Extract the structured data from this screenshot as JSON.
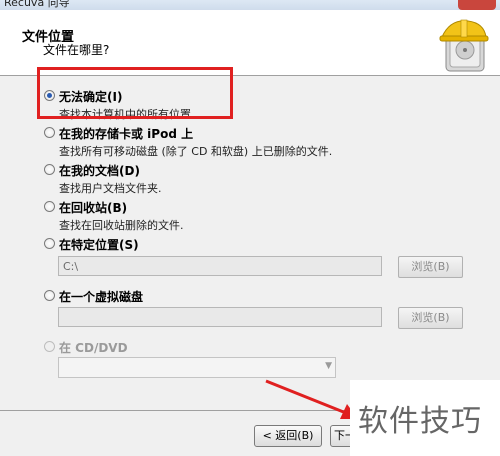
{
  "window": {
    "title": "Recuva 向导"
  },
  "header": {
    "title": "文件位置",
    "subtitle": "文件在哪里?"
  },
  "options": [
    {
      "label": "无法确定(I)",
      "desc": "查找本计算机中的所有位置.",
      "checked": true
    },
    {
      "label": "在我的存储卡或 iPod 上",
      "desc": "查找所有可移动磁盘 (除了 CD 和软盘) 上已删除的文件."
    },
    {
      "label": "在我的文档(D)",
      "desc": "查找用户文档文件夹."
    },
    {
      "label": "在回收站(B)",
      "desc": "查找在回收站删除的文件."
    },
    {
      "label": "在特定位置(S)",
      "path_value": "C:\\",
      "browse_label": "浏览(B)"
    },
    {
      "label": "在一个虚拟磁盘",
      "browse_label": "浏览(B)"
    },
    {
      "label": "在 CD/DVD",
      "disabled": true
    }
  ],
  "footer": {
    "back_label": "< 返回(B)",
    "next_label": "下一"
  },
  "watermark": {
    "text": "软件技巧"
  },
  "colors": {
    "highlight": "#e02020",
    "accent": "#2a5bb0"
  }
}
